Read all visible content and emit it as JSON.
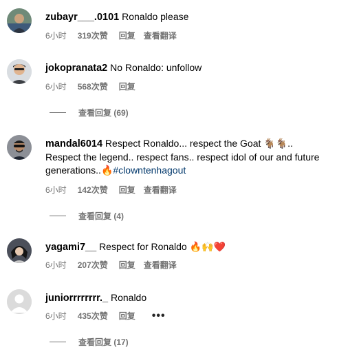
{
  "comments": [
    {
      "username": "zubayr___.0101",
      "text": "Ronaldo please",
      "time": "6小时",
      "likes": "319次赞",
      "reply": "回复",
      "translate": "查看翻译"
    },
    {
      "username": "jokopranata2",
      "text": "No Ronaldo: unfollow",
      "time": "6小时",
      "likes": "568次赞",
      "reply": "回复",
      "view_replies": "查看回复 (69)"
    },
    {
      "username": "mandal6014",
      "text": "Respect Ronaldo... respect the Goat 🐐🐐.. Respect the legend.. respect fans.. respect idol of our and future generations..🔥",
      "hashtag": "#clowntenhagout",
      "time": "6小时",
      "likes": "142次赞",
      "reply": "回复",
      "translate": "查看翻译",
      "view_replies": "查看回复 (4)"
    },
    {
      "username": "yagami7__",
      "text": "Respect for Ronaldo 🔥🙌❤️",
      "time": "6小时",
      "likes": "207次赞",
      "reply": "回复",
      "translate": "查看翻译"
    },
    {
      "username": "juniorrrrrrrr._",
      "text": "Ronaldo",
      "time": "6小时",
      "likes": "435次赞",
      "reply": "回复",
      "more": "•••",
      "view_replies": "查看回复 (17)"
    }
  ],
  "colors": {
    "meta_text": "#737373",
    "hashtag": "#00376b",
    "heart": "#ed4956"
  }
}
